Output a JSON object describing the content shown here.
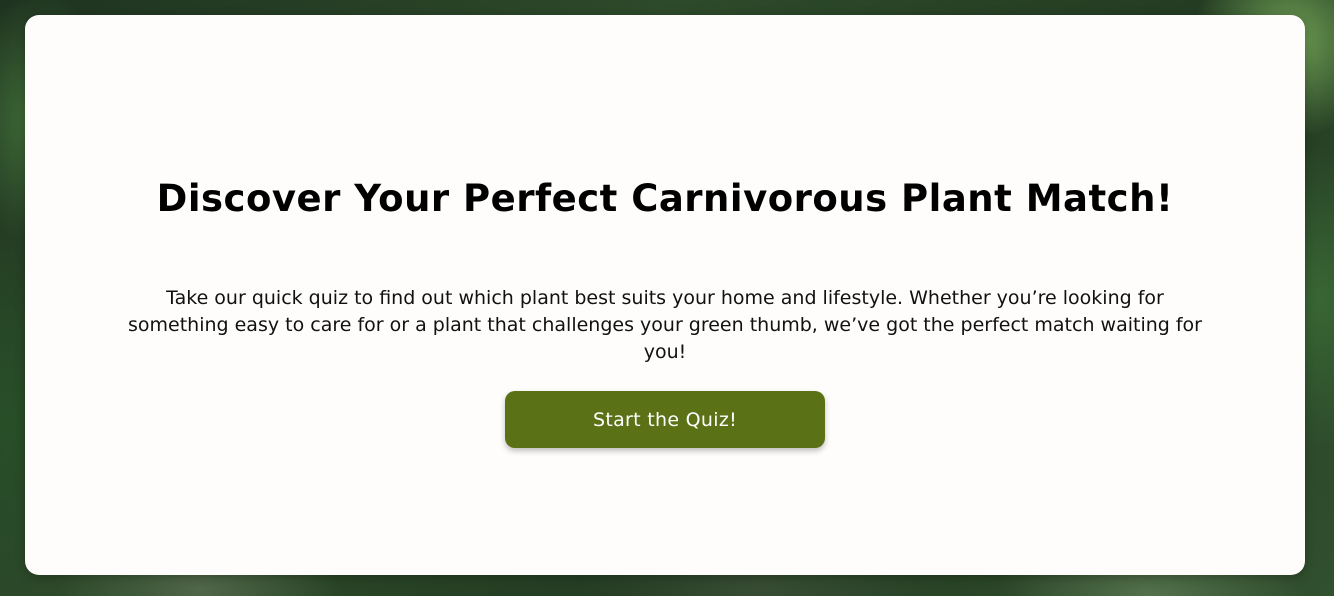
{
  "hero": {
    "title": "Discover Your Perfect Carnivorous Plant Match!",
    "description": "Take our quick quiz to find out which plant best suits your home and lifestyle. Whether you’re looking for something easy to care for or a plant that challenges your green thumb, we’ve got the perfect match waiting for you!",
    "cta_label": "Start the Quiz!"
  },
  "colors": {
    "card_background": "#fefdfb",
    "button_background": "#5a7115",
    "button_text": "#ffffff",
    "title_text": "#000000"
  }
}
